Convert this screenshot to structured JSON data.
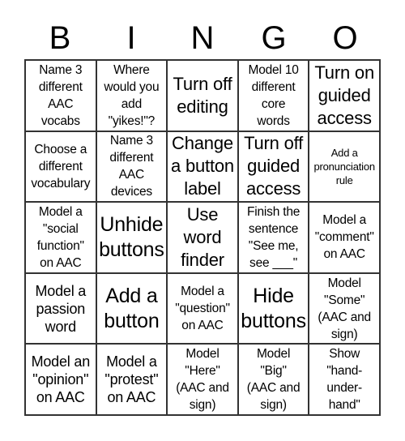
{
  "header": [
    "B",
    "I",
    "N",
    "G",
    "O"
  ],
  "cells": [
    "Name 3\ndifferent\nAAC\nvocabs",
    "Where\nwould you\nadd\n\"yikes!\"?",
    "Turn off\nediting",
    "Model 10\ndifferent\ncore\nwords",
    "Turn on\nguided\naccess",
    "Choose a\ndifferent\nvocabulary",
    "Name 3\ndifferent\nAAC\ndevices",
    "Change\na button\nlabel",
    "Turn off\nguided\naccess",
    "Add a\npronunciation\nrule",
    "Model a\n\"social\nfunction\"\non AAC",
    "Unhide\nbuttons",
    "Use\nword\nfinder",
    "Finish the\nsentence\n\"See me,\nsee ___\"",
    "Model a\n\"comment\"\non AAC",
    "Model a\npassion\nword",
    "Add a\nbutton",
    "Model a\n\"question\"\non AAC",
    "Hide\nbuttons",
    "Model\n\"Some\"\n(AAC and\nsign)",
    "Model an\n\"opinion\"\non AAC",
    "Model a\n\"protest\"\non AAC",
    "Model\n\"Here\"\n(AAC and\nsign)",
    "Model\n\"Big\"\n(AAC and\nsign)",
    "Show\n\"hand-\nunder-\nhand\""
  ]
}
